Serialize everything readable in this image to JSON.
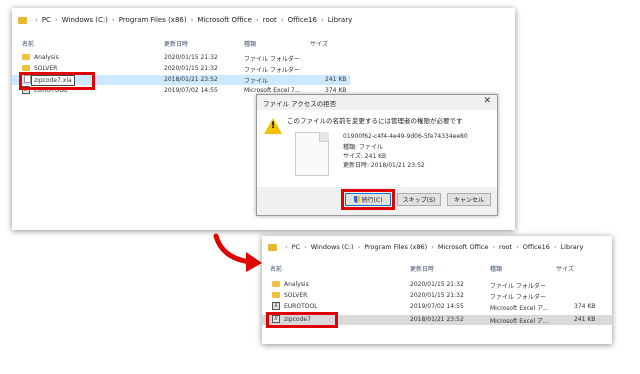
{
  "top_explorer": {
    "breadcrumb": [
      "PC",
      "Windows (C:)",
      "Program Files (x86)",
      "Microsoft Office",
      "root",
      "Office16",
      "Library"
    ],
    "columns": {
      "name": "名前",
      "date": "更新日時",
      "type": "種類",
      "size": "サイズ"
    },
    "rows": [
      {
        "name": "Analysis",
        "date": "2020/01/15 21:32",
        "type": "ファイル フォルダー",
        "size": ""
      },
      {
        "name": "SOLVER",
        "date": "2020/01/15 21:32",
        "type": "ファイル フォルダー",
        "size": ""
      },
      {
        "name": "zipcode7.xla",
        "date": "2018/01/21 23:52",
        "type": "ファイル",
        "size": "241 KB"
      },
      {
        "name": "EUROTOOL",
        "date": "2019/07/02 14:55",
        "type": "Microsoft Excel 7...",
        "size": "374 KB"
      }
    ]
  },
  "dialog": {
    "title": "ファイル アクセスの拒否",
    "close": "✕",
    "message": "このファイルの名前を変更するには管理者の権限が必要です",
    "file_name": "01900f62-c4f4-4e49-9d06-5fe74334ee80",
    "file_type": "種類: ファイル",
    "file_size": "サイズ: 241 KB",
    "file_date": "更新日時: 2018/01/21 23:52",
    "continue": "続行(C)",
    "skip": "スキップ(S)",
    "cancel": "キャンセル"
  },
  "bottom_explorer": {
    "breadcrumb": [
      "PC",
      "Windows (C:)",
      "Program Files (x86)",
      "Microsoft Office",
      "root",
      "Office16",
      "Library"
    ],
    "columns": {
      "name": "名前",
      "date": "更新日時",
      "type": "種類",
      "size": "サイズ"
    },
    "rows": [
      {
        "name": "Analysis",
        "date": "2020/01/15 21:32",
        "type": "ファイル フォルダー",
        "size": ""
      },
      {
        "name": "SOLVER",
        "date": "2020/01/15 21:32",
        "type": "ファイル フォルダー",
        "size": ""
      },
      {
        "name": "EUROTOOL",
        "date": "2019/07/02 14:55",
        "type": "Microsoft Excel ア...",
        "size": "374 KB"
      },
      {
        "name": "zipcode7",
        "date": "2018/01/21 23:52",
        "type": "Microsoft Excel ア...",
        "size": "241 KB"
      }
    ]
  },
  "colors": {
    "highlight_box": "#e00000",
    "selection": "#cce8ff",
    "folder": "#f0c040",
    "arrow": "#e00000"
  },
  "icons": [
    "folder-icon",
    "document-icon",
    "excel-addin-icon",
    "warning-icon",
    "shield-icon",
    "close-icon",
    "arrow-icon"
  ]
}
